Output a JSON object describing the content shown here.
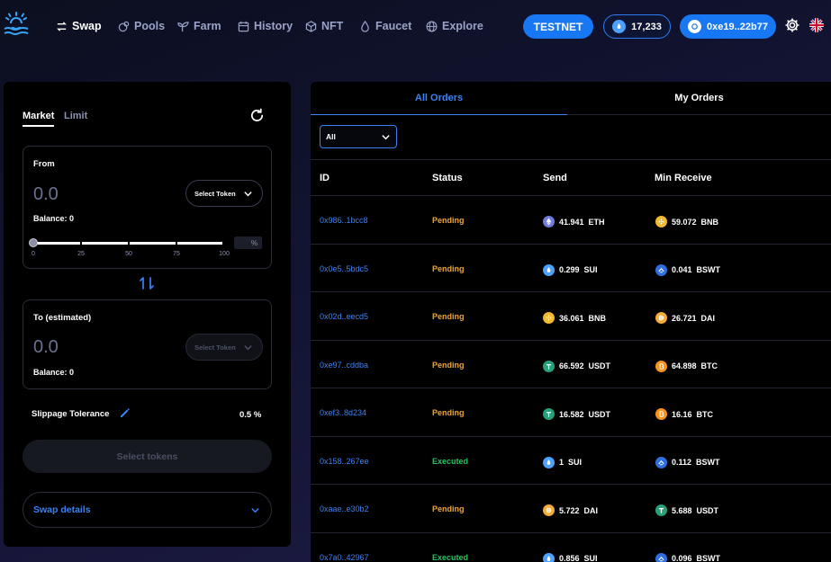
{
  "nav": {
    "items": [
      {
        "label": "Swap",
        "icon": "swap-arrows-icon",
        "active": true
      },
      {
        "label": "Pools",
        "icon": "pools-icon"
      },
      {
        "label": "Farm",
        "icon": "sprout-icon"
      },
      {
        "label": "History",
        "icon": "calendar-icon"
      },
      {
        "label": "NFT",
        "icon": "cube-icon"
      },
      {
        "label": "Faucet",
        "icon": "drop-icon"
      },
      {
        "label": "Explore",
        "icon": "globe-icon"
      }
    ],
    "network": "TESTNET",
    "balance": "17,233",
    "wallet": "0xe19..22b77"
  },
  "swap": {
    "tabs": [
      "Market",
      "Limit"
    ],
    "from": {
      "label": "From",
      "amount": "0.0",
      "balance": "Balance: 0",
      "select": "Select Token",
      "slider_marks": [
        "0",
        "25",
        "50",
        "75",
        "100"
      ],
      "slider_value": 0,
      "pct_unit": "%"
    },
    "to": {
      "label": "To (estimated)",
      "amount": "0.0",
      "balance": "Balance: 0",
      "select": "Select Token"
    },
    "slippage_label": "Slippage Tolerance",
    "slippage_value": "0.5 %",
    "action": "Select tokens",
    "details": "Swap details"
  },
  "orders": {
    "tabs": [
      "All Orders",
      "My Orders"
    ],
    "filter": "All",
    "columns": [
      "ID",
      "Status",
      "Send",
      "Min Receive"
    ],
    "rows": [
      {
        "id": "0x986..1bcc8",
        "status": "Pending",
        "send_amt": "41.941",
        "send_tok": "ETH",
        "recv_amt": "59.072",
        "recv_tok": "BNB"
      },
      {
        "id": "0x0e5..5bdc5",
        "status": "Pending",
        "send_amt": "0.299",
        "send_tok": "SUI",
        "recv_amt": "0.041",
        "recv_tok": "BSWT"
      },
      {
        "id": "0x02d..eecd5",
        "status": "Pending",
        "send_amt": "36.061",
        "send_tok": "BNB",
        "recv_amt": "26.721",
        "recv_tok": "DAI"
      },
      {
        "id": "0xe97..cddba",
        "status": "Pending",
        "send_amt": "66.592",
        "send_tok": "USDT",
        "recv_amt": "64.898",
        "recv_tok": "BTC"
      },
      {
        "id": "0xef3..8d234",
        "status": "Pending",
        "send_amt": "16.582",
        "send_tok": "USDT",
        "recv_amt": "16.16",
        "recv_tok": "BTC"
      },
      {
        "id": "0x158..267ee",
        "status": "Executed",
        "send_amt": "1",
        "send_tok": "SUI",
        "recv_amt": "0.112",
        "recv_tok": "BSWT"
      },
      {
        "id": "0xaae..e30b2",
        "status": "Pending",
        "send_amt": "5.722",
        "send_tok": "DAI",
        "recv_amt": "5.688",
        "recv_tok": "USDT"
      },
      {
        "id": "0x7a0..42967",
        "status": "Executed",
        "send_amt": "0.856",
        "send_tok": "SUI",
        "recv_amt": "0.096",
        "recv_tok": "BSWT"
      }
    ]
  },
  "colors": {
    "accent": "#1877f2",
    "link": "#3b82f6",
    "pending": "#f0a431",
    "executed": "#22c55e",
    "token": {
      "ETH": "#6f7ddc",
      "SUI": "#4da2ff",
      "BNB": "#f3ba2f",
      "USDT": "#26a17b",
      "BTC": "#f7931a",
      "DAI": "#f5ac37",
      "BSWT": "#2f6fe4"
    }
  }
}
